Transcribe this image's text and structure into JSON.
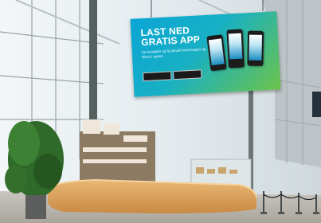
{
  "billboard": {
    "headline": "LAST NED GRATIS APP",
    "subtext": "Se bordplan og få aktuell informasjon og tilbud i appen.",
    "store_badges": [
      "App Store",
      "Google Play"
    ]
  },
  "colors": {
    "billboard_blue": "#0aa5d6",
    "billboard_green": "#6cc34a",
    "counter_wood": "#d9a25e",
    "plant_green": "#2f6a2a"
  }
}
